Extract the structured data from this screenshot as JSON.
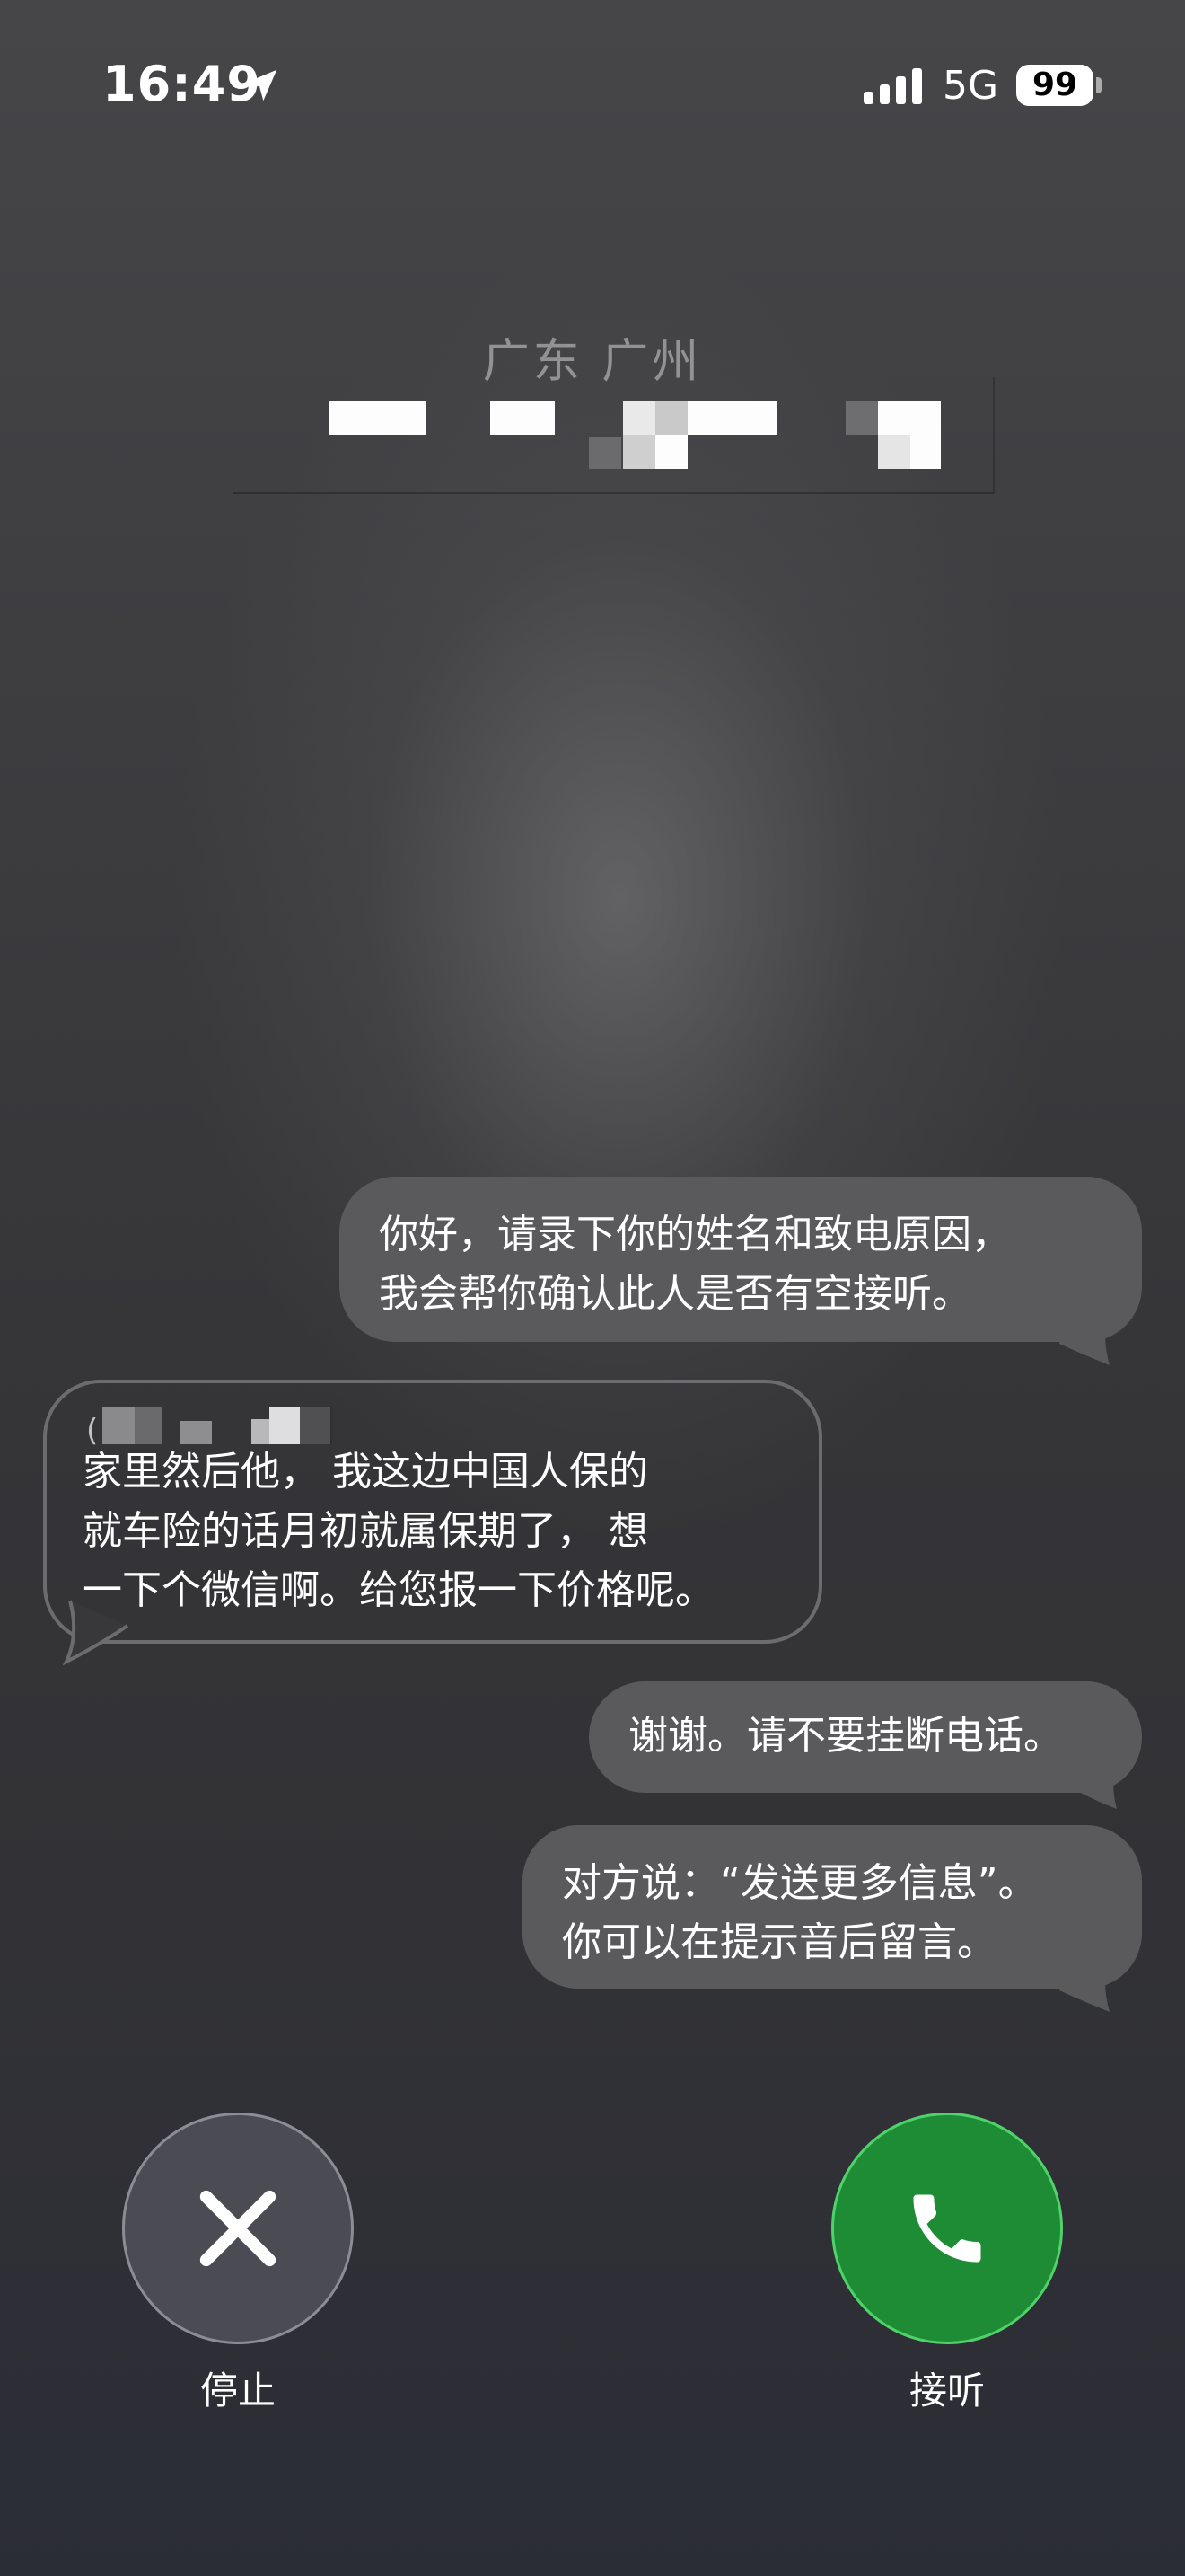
{
  "status_bar": {
    "time": "16:49",
    "location_icon": "location-arrow-icon",
    "signal_icon": "cellular-signal-icon",
    "network": "5G",
    "battery_level": "99"
  },
  "caller": {
    "location": "广东 广州"
  },
  "messages": [
    {
      "side": "right",
      "lines": [
        "你好，请录下你的姓名和致电原因，",
        "我会帮你确认此人是否有空接听。"
      ]
    },
    {
      "side": "left",
      "prefix": "(",
      "lines": [
        "家里然后他， 我这边中国人保的",
        "就车险的话月初就属保期了， 想",
        "一下个微信啊。给您报一下价格呢。"
      ]
    },
    {
      "side": "right",
      "lines": [
        "谢谢。请不要挂断电话。"
      ]
    },
    {
      "side": "right",
      "lines": [
        "对方说：“发送更多信息”。",
        "你可以在提示音后留言。"
      ]
    }
  ],
  "actions": {
    "stop": {
      "label": "停止",
      "icon": "close-x-icon",
      "color": "#4a4b53"
    },
    "answer": {
      "label": "接听",
      "icon": "phone-icon",
      "color": "#1e8c35"
    }
  }
}
